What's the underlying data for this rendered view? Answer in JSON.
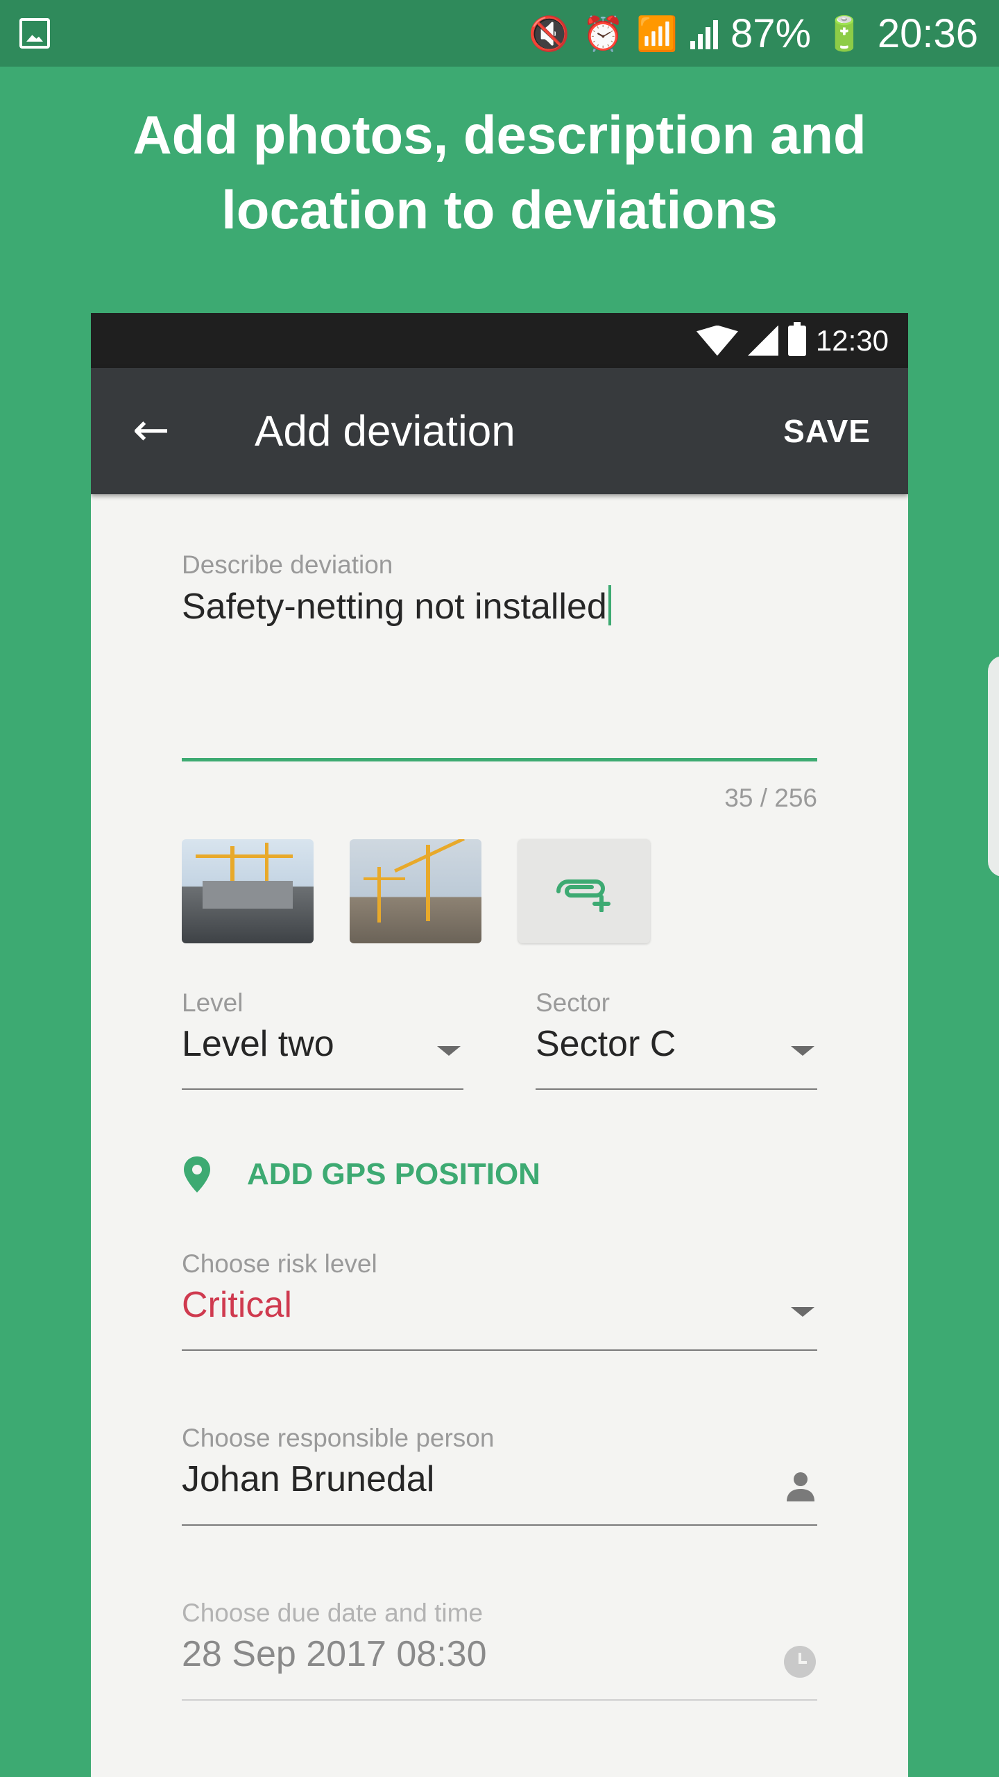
{
  "status_bar": {
    "battery_percent": "87%",
    "time": "20:36",
    "icons": [
      "gallery-icon",
      "mute-vibrate-icon",
      "alarm-icon",
      "wifi-icon",
      "signal-icon",
      "battery-charging-icon"
    ]
  },
  "headline": {
    "line1": "Add photos, description and",
    "line2": "location to deviations"
  },
  "phone": {
    "status_time": "12:30",
    "appbar": {
      "title": "Add deviation",
      "save_label": "SAVE"
    },
    "form": {
      "description": {
        "label": "Describe deviation",
        "value": "Safety-netting not installed",
        "counter": "35 / 256"
      },
      "attachments": {
        "thumbnails": [
          "construction-crane-photo-1",
          "construction-crane-photo-2"
        ],
        "add_icon": "attach-add-icon"
      },
      "level": {
        "label": "Level",
        "value": "Level two"
      },
      "sector": {
        "label": "Sector",
        "value": "Sector C"
      },
      "gps_button_label": "ADD GPS POSITION",
      "risk": {
        "label": "Choose risk level",
        "value": "Critical"
      },
      "responsible": {
        "label": "Choose responsible person",
        "value": "Johan Brunedal"
      },
      "due": {
        "label": "Choose due date and time",
        "value": "28 Sep 2017 08:30"
      }
    }
  },
  "colors": {
    "background": "#3daa72",
    "accent": "#3daa72",
    "appbar": "#373a3d",
    "critical": "#cf3a4f"
  }
}
